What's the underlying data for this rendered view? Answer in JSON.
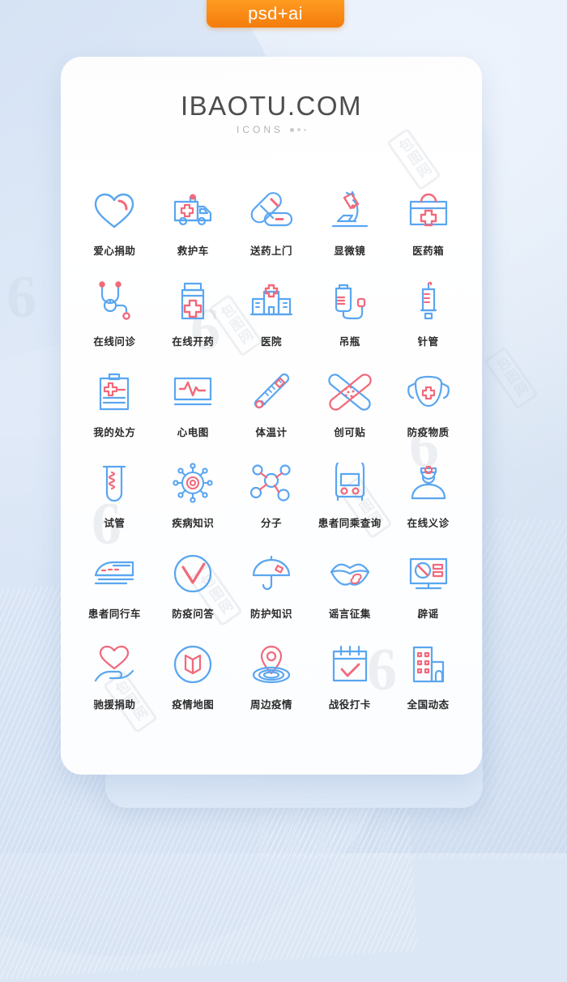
{
  "badge": {
    "label": "psd+ai",
    "color": "#f7820e"
  },
  "header": {
    "title": "IBAOTU.COM",
    "subtitle": "ICONS"
  },
  "theme": {
    "icon_blue": "#5aa6f0",
    "icon_red": "#f2697a",
    "label_color": "#2b2b2b",
    "card_bg": "#ffffff",
    "page_bg": "#dce7f5"
  },
  "watermark": {
    "text": "包图网",
    "mark": "6"
  },
  "icons": [
    {
      "name": "heart-donation-icon",
      "label": "爱心捐助"
    },
    {
      "name": "ambulance-icon",
      "label": "救护车"
    },
    {
      "name": "medicine-delivery-icon",
      "label": "送药上门"
    },
    {
      "name": "microscope-icon",
      "label": "显微镜"
    },
    {
      "name": "medical-kit-icon",
      "label": "医药箱"
    },
    {
      "name": "stethoscope-icon",
      "label": "在线问诊"
    },
    {
      "name": "medicine-bottle-icon",
      "label": "在线开药"
    },
    {
      "name": "hospital-icon",
      "label": "医院"
    },
    {
      "name": "iv-drip-icon",
      "label": "吊瓶"
    },
    {
      "name": "syringe-icon",
      "label": "针管"
    },
    {
      "name": "prescription-clipboard-icon",
      "label": "我的处方"
    },
    {
      "name": "ecg-monitor-icon",
      "label": "心电图"
    },
    {
      "name": "thermometer-icon",
      "label": "体温计"
    },
    {
      "name": "bandage-icon",
      "label": "创可贴"
    },
    {
      "name": "face-mask-icon",
      "label": "防疫物质"
    },
    {
      "name": "test-tube-icon",
      "label": "试管"
    },
    {
      "name": "virus-icon",
      "label": "疾病知识"
    },
    {
      "name": "molecule-icon",
      "label": "分子"
    },
    {
      "name": "bus-icon",
      "label": "患者同乘查询"
    },
    {
      "name": "doctor-icon",
      "label": "在线义诊"
    },
    {
      "name": "train-icon",
      "label": "患者同行车"
    },
    {
      "name": "check-circle-icon",
      "label": "防疫问答"
    },
    {
      "name": "umbrella-icon",
      "label": "防护知识"
    },
    {
      "name": "lips-icon",
      "label": "谣言征集"
    },
    {
      "name": "monitor-ban-icon",
      "label": "辟谣"
    },
    {
      "name": "hand-heart-icon",
      "label": "驰援捐助"
    },
    {
      "name": "map-circle-icon",
      "label": "疫情地图"
    },
    {
      "name": "location-pin-icon",
      "label": "周边疫情"
    },
    {
      "name": "calendar-check-icon",
      "label": "战役打卡"
    },
    {
      "name": "buildings-icon",
      "label": "全国动态"
    }
  ]
}
